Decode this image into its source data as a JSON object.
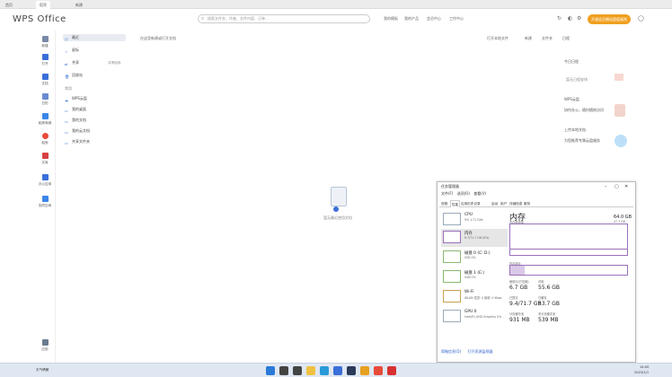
{
  "tabs": [
    {
      "label": "首页"
    },
    {
      "label": "稻壳"
    },
    {
      "label": "新建"
    }
  ],
  "header": {
    "logo": "WPS Office",
    "search_placeholder": "搜索文件名、作者、文件内容、订单…",
    "links": [
      "我的模板",
      "我的产品",
      "会员中心",
      "工作中心"
    ],
    "member_button": "开通会员赠送超值福利"
  },
  "leftbar": [
    {
      "label": "新建",
      "color": "#7a8aa8"
    },
    {
      "label": "打开",
      "color": "#3a6fd8"
    },
    {
      "label": "文档",
      "color": "#3a6fd8"
    },
    {
      "label": "日历",
      "color": "#6a8bd0"
    },
    {
      "label": "稻壳商城",
      "color": "#3a86e8"
    },
    {
      "label": "稻壳",
      "color": "#e84a3a"
    },
    {
      "label": "文库",
      "color": "#d84040"
    },
    {
      "label": "办公应用",
      "color": "#3a6fd8"
    },
    {
      "label": "协同空间",
      "color": "#3a86e8"
    },
    {
      "label": "应用",
      "color": "#6a7a90"
    }
  ],
  "nav": {
    "items": [
      "最近",
      "星标",
      "共享",
      "回收站"
    ],
    "shared_note": "共享给我",
    "section_label": "常用",
    "favorites": [
      "WPS云盘",
      "我的桌面",
      "我的文档",
      "我的云文档",
      "共享文件夹"
    ]
  },
  "main": {
    "toolbar_hint": "在这里新建或打开文档",
    "actions": [
      "打开本地文件",
      "新建",
      "文件夹"
    ],
    "empty_text": "暂无最近使用文档"
  },
  "rightpanel": {
    "title": "日程",
    "items": [
      "今日日程",
      "暂无日程安排",
      "WPS云盘",
      "协作办公，随时随地访问",
      "上传本地文档",
      "为您推荐专属云盘服务"
    ]
  },
  "taskmanager": {
    "title": "任务管理器",
    "menu": [
      "文件(F)",
      "选项(O)",
      "查看(V)"
    ],
    "tabs": [
      "进程",
      "性能",
      "应用历史记录",
      "启动",
      "用户",
      "详细信息",
      "服务"
    ],
    "side": [
      {
        "name": "CPU",
        "sub": "5%  1.71 GHz"
      },
      {
        "name": "内存",
        "sub": "6.7/71.7 GB (9%)"
      },
      {
        "name": "磁盘 0 (C: D:)",
        "sub": "SSD\n0%"
      },
      {
        "name": "磁盘 1 (E:)",
        "sub": "USB\n0%"
      },
      {
        "name": "Wi-Fi",
        "sub": "WLAN\n发送: 0 接收: 0 Kbps"
      },
      {
        "name": "GPU 0",
        "sub": "Intel(R) UHD Graphics\n0%"
      }
    ],
    "main_title": "内存",
    "total": "64.0 GB",
    "graph_label": "内存使用量",
    "graph_max": "47.7 GB",
    "composition_label": "内存组合",
    "stats": [
      {
        "label": "使用中(已压缩)",
        "value": "6.7 GB"
      },
      {
        "label": "可用",
        "value": "55.6 GB"
      },
      {
        "label": "已提交",
        "value": "9.4/71.7 GB"
      },
      {
        "label": "已缓存",
        "value": "53.7 GB"
      },
      {
        "label": "分页缓冲池",
        "value": "931 MB"
      },
      {
        "label": "非分页缓冲池",
        "value": "539 MB"
      }
    ],
    "footer": [
      "简略信息(D)",
      "打开资源监视器"
    ]
  },
  "taskbar": {
    "left_text": "天气晴朗",
    "icons": [
      {
        "name": "start-icon",
        "color": "#2a7ad8"
      },
      {
        "name": "search-icon",
        "color": "#444"
      },
      {
        "name": "taskview-icon",
        "color": "#444"
      },
      {
        "name": "explorer-icon",
        "color": "#f0c040"
      },
      {
        "name": "edge-icon",
        "color": "#2a9ad8"
      },
      {
        "name": "store-icon",
        "color": "#3a6fd8"
      },
      {
        "name": "steam-icon",
        "color": "#2a3a58"
      },
      {
        "name": "chrome-icon",
        "color": "#e8a020"
      },
      {
        "name": "app-icon",
        "color": "#e84a3a"
      },
      {
        "name": "wps-icon",
        "color": "#d83030"
      }
    ],
    "time": "14:00",
    "date": "2023/1/1"
  }
}
